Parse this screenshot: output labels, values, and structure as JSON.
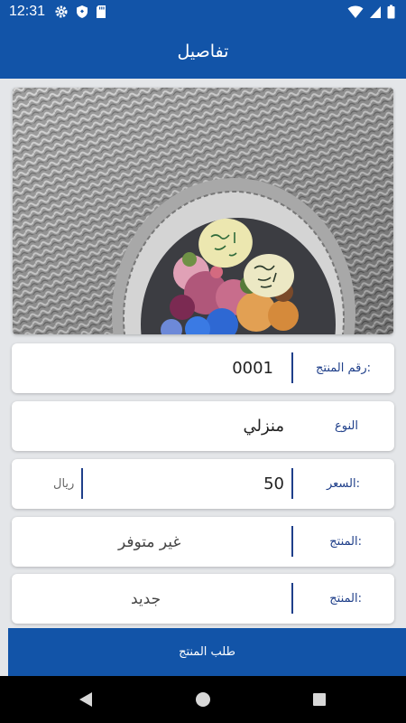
{
  "status_bar": {
    "time": "12:31",
    "icons": [
      "gear-icon",
      "shield-icon",
      "sd-card-icon",
      "wifi-icon",
      "signal-icon",
      "battery-icon"
    ]
  },
  "app_bar": {
    "title": "تفاصيل"
  },
  "product_image": {
    "alt": ""
  },
  "fields": {
    "product_number": {
      "label": "رقم المنتج:",
      "value": "0001"
    },
    "type": {
      "label": "النوع",
      "value": "منزلي"
    },
    "price": {
      "label": "السعر:",
      "value": "50",
      "unit": "ريال"
    },
    "availability": {
      "label": "المنتج:",
      "value": "غير متوفر"
    },
    "condition": {
      "label": "المنتج:",
      "value": "جديد"
    }
  },
  "order_button": {
    "label": "طلب المنتج"
  },
  "nav_bar": {
    "icons": [
      "back-icon",
      "home-icon",
      "recents-icon"
    ]
  },
  "colors": {
    "primary": "#1254a8",
    "label": "#1f3f8a",
    "background": "#e4e6e9"
  }
}
